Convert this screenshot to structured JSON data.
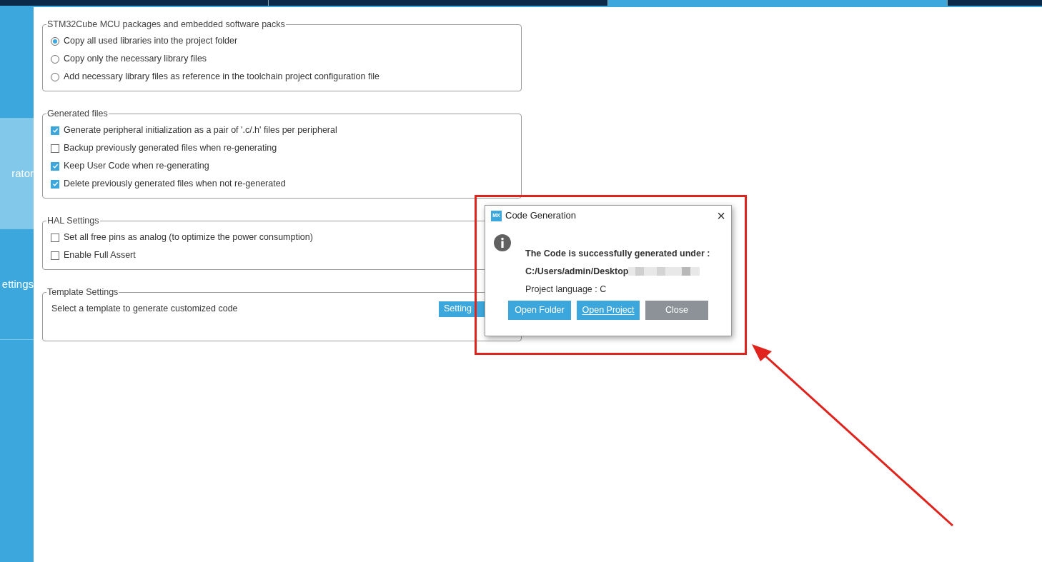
{
  "tabs": [
    {
      "selected": false
    },
    {
      "selected": false
    },
    {
      "selected": true
    }
  ],
  "sidebar": {
    "items": [
      {
        "selected": false
      },
      {
        "label": "rator",
        "selected": true
      },
      {
        "label": "ettings",
        "selected": false
      }
    ]
  },
  "groups": [
    {
      "title": "STM32Cube MCU packages and embedded software packs",
      "options": [
        {
          "kind": "radio",
          "label": "Copy all used libraries into the project folder",
          "selected": true
        },
        {
          "kind": "radio",
          "label": "Copy only the necessary library files",
          "selected": false
        },
        {
          "kind": "radio",
          "label": "Add necessary library files as reference in the toolchain project configuration file",
          "selected": false
        }
      ]
    },
    {
      "title": "Generated files",
      "options": [
        {
          "kind": "checkbox",
          "label": "Generate peripheral initialization as a pair of '.c/.h' files per peripheral",
          "checked": true
        },
        {
          "kind": "checkbox",
          "label": "Backup previously generated files when re-generating",
          "checked": false
        },
        {
          "kind": "checkbox",
          "label": "Keep User Code when re-generating",
          "checked": true
        },
        {
          "kind": "checkbox",
          "label": "Delete previously generated files when not re-generated",
          "checked": true
        }
      ]
    },
    {
      "title": "HAL Settings",
      "options": [
        {
          "kind": "checkbox",
          "label": "Set all free pins as analog (to optimize the power consumption)",
          "checked": false
        },
        {
          "kind": "checkbox",
          "label": "Enable Full Assert",
          "checked": false
        }
      ]
    },
    {
      "title": "Template Settings",
      "options": [
        {
          "kind": "text",
          "label": "Select a template to generate customized code",
          "button": "Setting"
        }
      ]
    }
  ],
  "dialog": {
    "logo": "MX",
    "title": "Code Generation",
    "close": "×",
    "message": "The Code is successfully generated under :",
    "path": "C:/Users/admin/Desktop",
    "language": "Project language : C",
    "buttons": [
      {
        "label": "Open Folder",
        "kind": "primary"
      },
      {
        "label": "Open Project",
        "kind": "focused"
      },
      {
        "label": "Close",
        "kind": "secondary"
      }
    ]
  }
}
